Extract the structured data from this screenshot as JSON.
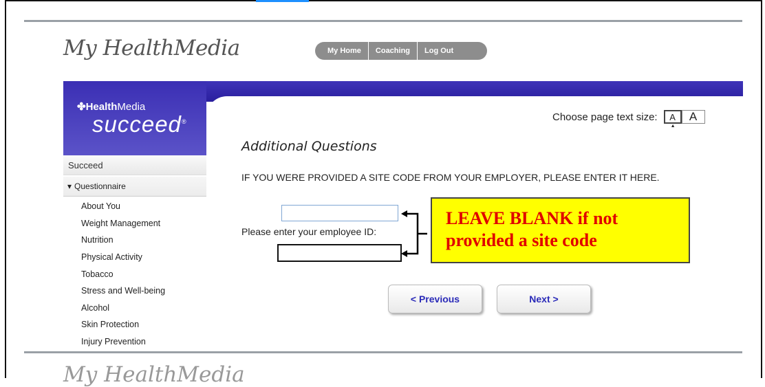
{
  "header": {
    "logo_text": "My HealthMedia",
    "nav": [
      "My Home",
      "Coaching",
      "Log Out"
    ]
  },
  "brand": {
    "company_bold": "Health",
    "company_light": "Media",
    "product": "succeed"
  },
  "sidebar": {
    "section": "Succeed",
    "subsection": "Questionnaire",
    "items": [
      "About You",
      "Weight Management",
      "Nutrition",
      "Physical Activity",
      "Tobacco",
      "Stress and Well-being",
      "Alcohol",
      "Skin Protection",
      "Injury Prevention"
    ]
  },
  "text_size": {
    "label": "Choose page text size:",
    "small": "A",
    "large": "A"
  },
  "form": {
    "title": "Additional Questions",
    "site_code_question": "IF YOU WERE PROVIDED A SITE CODE FROM YOUR EMPLOYER, PLEASE ENTER IT HERE.",
    "site_code_value": "",
    "employee_id_label": "Please enter your employee ID:",
    "employee_id_value": ""
  },
  "callout": {
    "line1": "LEAVE BLANK if not",
    "line2": "provided a site code"
  },
  "buttons": {
    "previous": "< Previous",
    "next": "Next >"
  },
  "colors": {
    "banner": "#2a1f9e",
    "callout_bg": "#ffff00",
    "callout_text": "#e00000",
    "button_text": "#2a2ab8"
  }
}
